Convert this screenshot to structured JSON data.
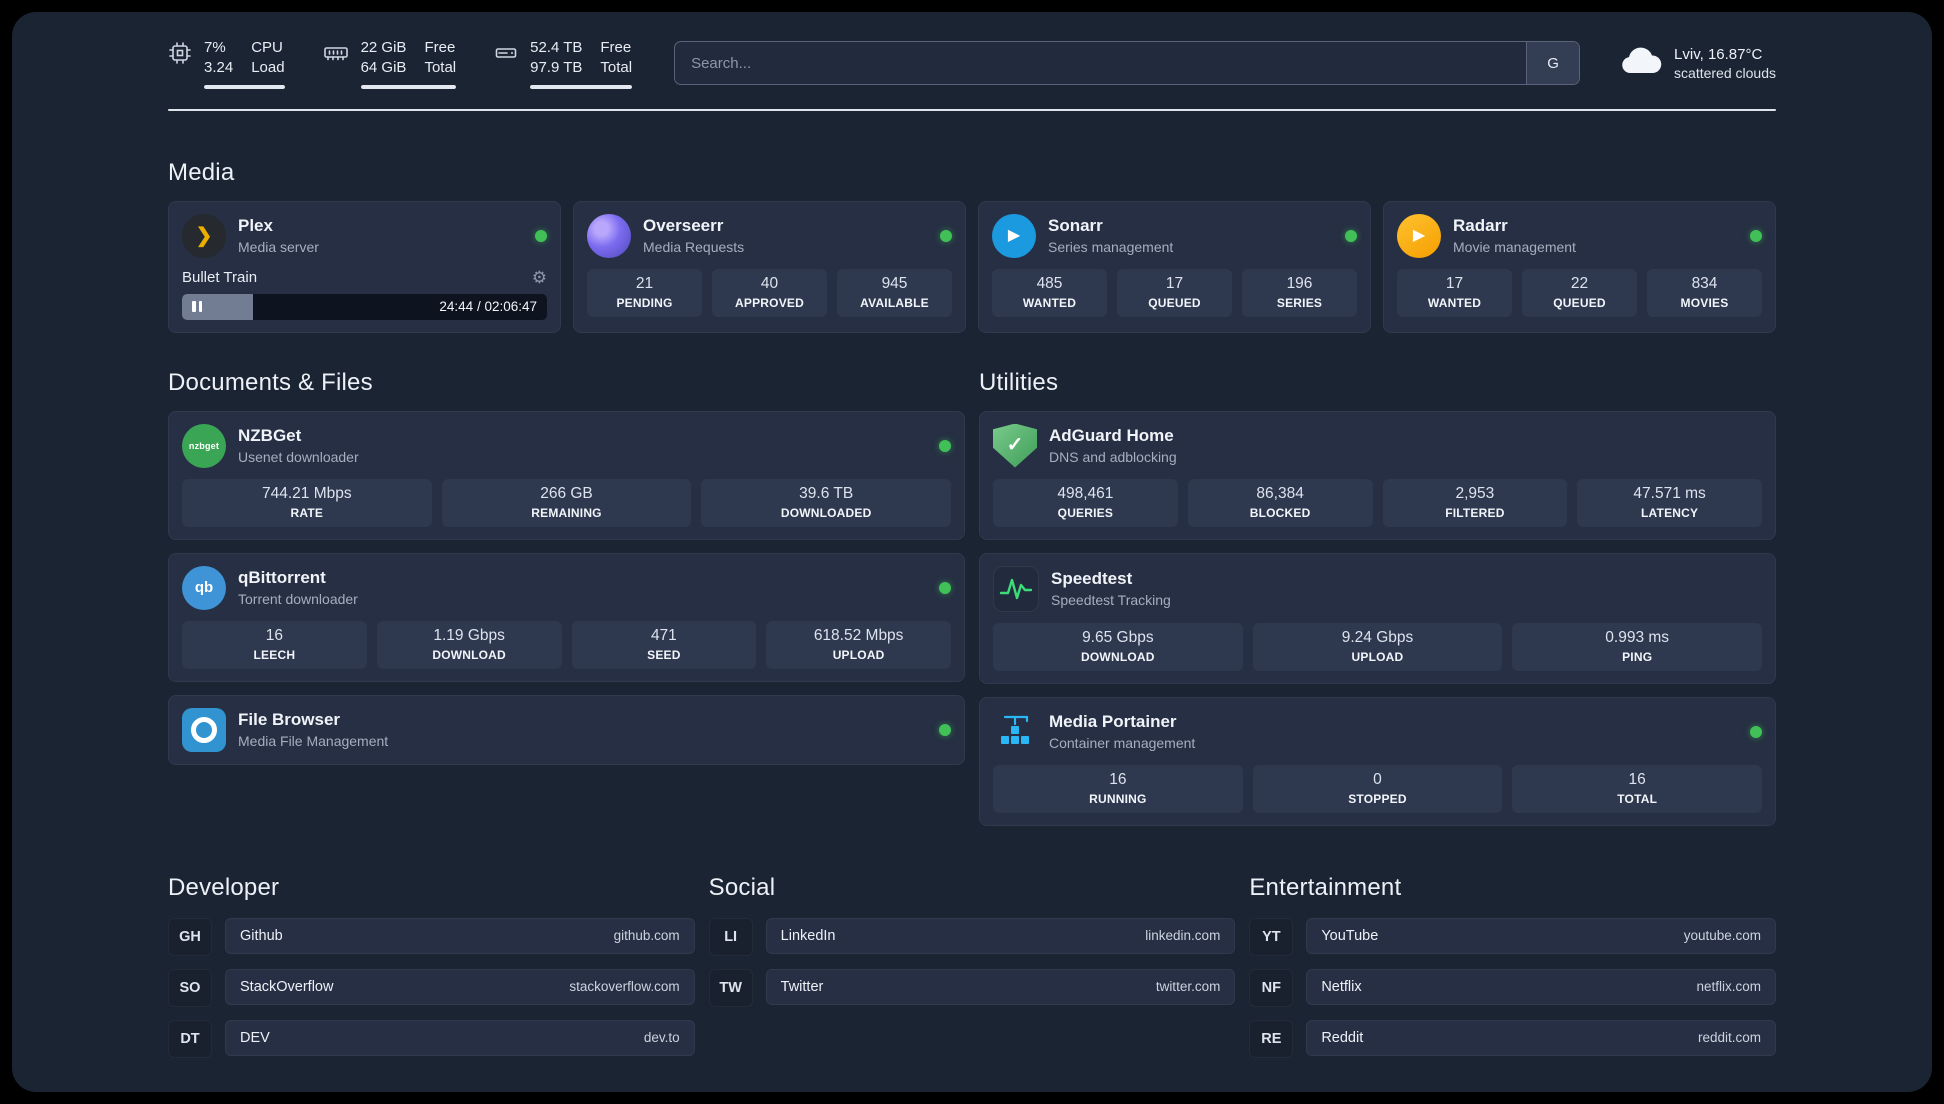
{
  "colors": {
    "status_online": "#40c057",
    "plex_accent": "#ebaf00",
    "overseerr_accent": "#7c6cf0",
    "sonarr_accent": "#1b9ae0",
    "radarr_accent": "#ffc230",
    "nzbget_accent": "#3aa655",
    "qbittorrent_accent": "#3e94d6",
    "filebrowser_accent": "#3194d1",
    "adguard_accent": "#4f9e58",
    "speedtest_accent": "#3ddc7a",
    "portainer_accent": "#29b8f5"
  },
  "header": {
    "cpu": {
      "value_top": "7%",
      "value_bottom": "3.24",
      "label_top": "CPU",
      "label_bottom": "Load"
    },
    "ram": {
      "value_top": "22 GiB",
      "value_bottom": "64 GiB",
      "label_top": "Free",
      "label_bottom": "Total"
    },
    "disk": {
      "value_top": "52.4 TB",
      "value_bottom": "97.9 TB",
      "label_top": "Free",
      "label_bottom": "Total"
    },
    "search": {
      "placeholder": "Search...",
      "engine_label": "G"
    },
    "weather": {
      "location": "Lviv, 16.87°C",
      "condition": "scattered clouds"
    }
  },
  "media": {
    "title": "Media",
    "plex": {
      "name": "Plex",
      "desc": "Media server",
      "now_playing": "Bullet Train",
      "time": "24:44 / 02:06:47",
      "progress_percent": 19.5
    },
    "overseerr": {
      "name": "Overseerr",
      "desc": "Media Requests",
      "stats": [
        {
          "value": "21",
          "label": "PENDING"
        },
        {
          "value": "40",
          "label": "APPROVED"
        },
        {
          "value": "945",
          "label": "AVAILABLE"
        }
      ]
    },
    "sonarr": {
      "name": "Sonarr",
      "desc": "Series management",
      "stats": [
        {
          "value": "485",
          "label": "WANTED"
        },
        {
          "value": "17",
          "label": "QUEUED"
        },
        {
          "value": "196",
          "label": "SERIES"
        }
      ]
    },
    "radarr": {
      "name": "Radarr",
      "desc": "Movie management",
      "stats": [
        {
          "value": "17",
          "label": "WANTED"
        },
        {
          "value": "22",
          "label": "QUEUED"
        },
        {
          "value": "834",
          "label": "MOVIES"
        }
      ]
    }
  },
  "documents": {
    "title": "Documents & Files",
    "nzbget": {
      "name": "NZBGet",
      "desc": "Usenet downloader",
      "icon_text": "nzbget",
      "stats": [
        {
          "value": "744.21 Mbps",
          "label": "RATE"
        },
        {
          "value": "266 GB",
          "label": "REMAINING"
        },
        {
          "value": "39.6 TB",
          "label": "DOWNLOADED"
        }
      ]
    },
    "qbittorrent": {
      "name": "qBittorrent",
      "desc": "Torrent downloader",
      "icon_text": "qb",
      "stats": [
        {
          "value": "16",
          "label": "LEECH"
        },
        {
          "value": "1.19 Gbps",
          "label": "DOWNLOAD"
        },
        {
          "value": "471",
          "label": "SEED"
        },
        {
          "value": "618.52 Mbps",
          "label": "UPLOAD"
        }
      ]
    },
    "filebrowser": {
      "name": "File Browser",
      "desc": "Media File Management"
    }
  },
  "utilities": {
    "title": "Utilities",
    "adguard": {
      "name": "AdGuard Home",
      "desc": "DNS and adblocking",
      "stats": [
        {
          "value": "498,461",
          "label": "QUERIES"
        },
        {
          "value": "86,384",
          "label": "BLOCKED"
        },
        {
          "value": "2,953",
          "label": "FILTERED"
        },
        {
          "value": "47.571 ms",
          "label": "LATENCY"
        }
      ]
    },
    "speedtest": {
      "name": "Speedtest",
      "desc": "Speedtest Tracking",
      "stats": [
        {
          "value": "9.65 Gbps",
          "label": "DOWNLOAD"
        },
        {
          "value": "9.24 Gbps",
          "label": "UPLOAD"
        },
        {
          "value": "0.993 ms",
          "label": "PING"
        }
      ]
    },
    "portainer": {
      "name": "Media Portainer",
      "desc": "Container management",
      "stats": [
        {
          "value": "16",
          "label": "RUNNING"
        },
        {
          "value": "0",
          "label": "STOPPED"
        },
        {
          "value": "16",
          "label": "TOTAL"
        }
      ]
    }
  },
  "links": {
    "developer": {
      "title": "Developer",
      "items": [
        {
          "badge": "GH",
          "name": "Github",
          "domain": "github.com"
        },
        {
          "badge": "SO",
          "name": "StackOverflow",
          "domain": "stackoverflow.com"
        },
        {
          "badge": "DT",
          "name": "DEV",
          "domain": "dev.to"
        }
      ]
    },
    "social": {
      "title": "Social",
      "items": [
        {
          "badge": "LI",
          "name": "LinkedIn",
          "domain": "linkedin.com"
        },
        {
          "badge": "TW",
          "name": "Twitter",
          "domain": "twitter.com"
        }
      ]
    },
    "entertainment": {
      "title": "Entertainment",
      "items": [
        {
          "badge": "YT",
          "name": "YouTube",
          "domain": "youtube.com"
        },
        {
          "badge": "NF",
          "name": "Netflix",
          "domain": "netflix.com"
        },
        {
          "badge": "RE",
          "name": "Reddit",
          "domain": "reddit.com"
        }
      ]
    }
  }
}
